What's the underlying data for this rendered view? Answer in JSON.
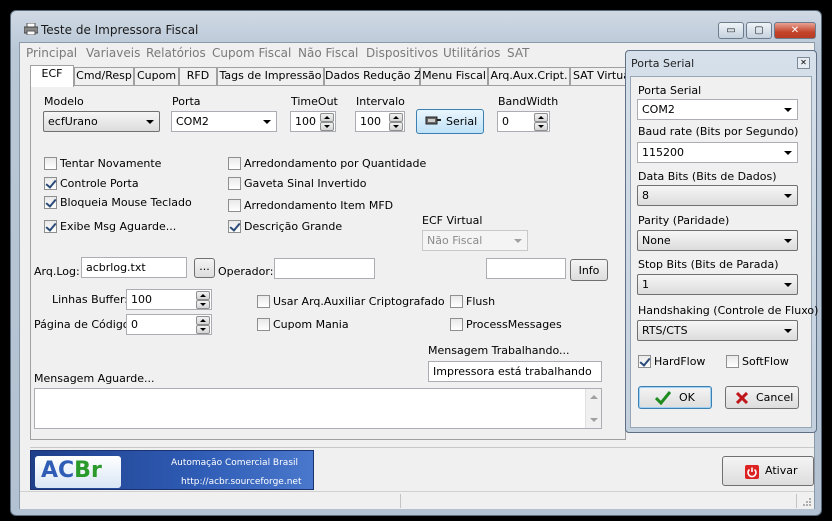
{
  "window": {
    "title": "Teste de Impressora Fiscal",
    "minimize": "▭",
    "maximize": "▢",
    "close": "✕"
  },
  "menu": [
    "Principal",
    "Variaveis",
    "Relatórios",
    "Cupom Fiscal",
    "Não Fiscal",
    "Dispositivos",
    "Utilitários",
    "SAT"
  ],
  "tabs": [
    "ECF",
    "Cmd/Resp",
    "Cupom",
    "RFD",
    "Tags de Impressão",
    "Dados Redução Z",
    "Menu Fiscal",
    "Arq.Aux.Cript.",
    "SAT Virtual"
  ],
  "ecf": {
    "modelo_label": "Modelo",
    "modelo_value": "ecfUrano",
    "porta_label": "Porta",
    "porta_value": "COM2",
    "timeout_label": "TimeOut",
    "timeout_value": "100",
    "intervalo_label": "Intervalo",
    "intervalo_value": "100",
    "serial_button": "Serial",
    "bandwidth_label": "BandWidth",
    "bandwidth_value": "0",
    "checks_left": [
      {
        "label": "Tentar Novamente",
        "checked": false
      },
      {
        "label": "Controle Porta",
        "checked": true
      },
      {
        "label": "Bloqueia Mouse Teclado",
        "checked": true
      },
      {
        "label": "Exibe Msg Aguarde...",
        "checked": true
      }
    ],
    "checks_mid": [
      {
        "label": "Arredondamento por Quantidade",
        "checked": false
      },
      {
        "label": "Gaveta Sinal Invertido",
        "checked": false
      },
      {
        "label": "Arredondamento Item MFD",
        "checked": false
      },
      {
        "label": "Descrição Grande",
        "checked": true
      }
    ],
    "ecf_virtual_label": "ECF Virtual",
    "ecf_virtual_value": "Não Fiscal",
    "arqlog_label": "Arq.Log:",
    "arqlog_value": "acbrlog.txt",
    "browse_button": "...",
    "operador_label": "Operador:",
    "operador_value": "",
    "info_value": "",
    "info_button": "Info",
    "linhas_buffer_label": "Linhas Buffer:",
    "linhas_buffer_value": "100",
    "pagina_codigo_label": "Página de Código:",
    "pagina_codigo_value": "0",
    "checks_bottom": [
      {
        "label": "Usar Arq.Auxiliar Criptografado",
        "checked": false
      },
      {
        "label": "Cupom Mania",
        "checked": false
      },
      {
        "label": "Flush",
        "checked": false
      },
      {
        "label": "ProcessMessages",
        "checked": false
      }
    ],
    "msg_trabalhando_label": "Mensagem Trabalhando...",
    "msg_trabalhando_value": "Impressora está trabalhando",
    "msg_aguarde_label": "Mensagem Aguarde..."
  },
  "footer": {
    "logo_text": "ACBr",
    "logo_caption": "Automação Comercial Brasil",
    "logo_url": "http://acbr.sourceforge.net",
    "ativar_button": "Ativar"
  },
  "dialog": {
    "title": "Porta Serial",
    "close": "✕",
    "porta_label": "Porta Serial",
    "porta_value": "COM2",
    "baud_label": "Baud rate (Bits por Segundo)",
    "baud_value": "115200",
    "databits_label": "Data Bits (Bits de Dados)",
    "databits_value": "8",
    "parity_label": "Parity (Paridade)",
    "parity_value": "None",
    "stopbits_label": "Stop Bits (Bits de Parada)",
    "stopbits_value": "1",
    "handshake_label": "Handshaking (Controle de Fluxo)",
    "handshake_value": "RTS/CTS",
    "hardflow_label": "HardFlow",
    "hardflow_checked": true,
    "softflow_label": "SoftFlow",
    "softflow_checked": false,
    "ok_button": "OK",
    "cancel_button": "Cancel"
  },
  "colors": {
    "ok_check": "#1e8b1e",
    "cancel_x": "#c0181a",
    "logo_blue": "#2f5cb5",
    "logo_green": "#2a9a2a"
  }
}
